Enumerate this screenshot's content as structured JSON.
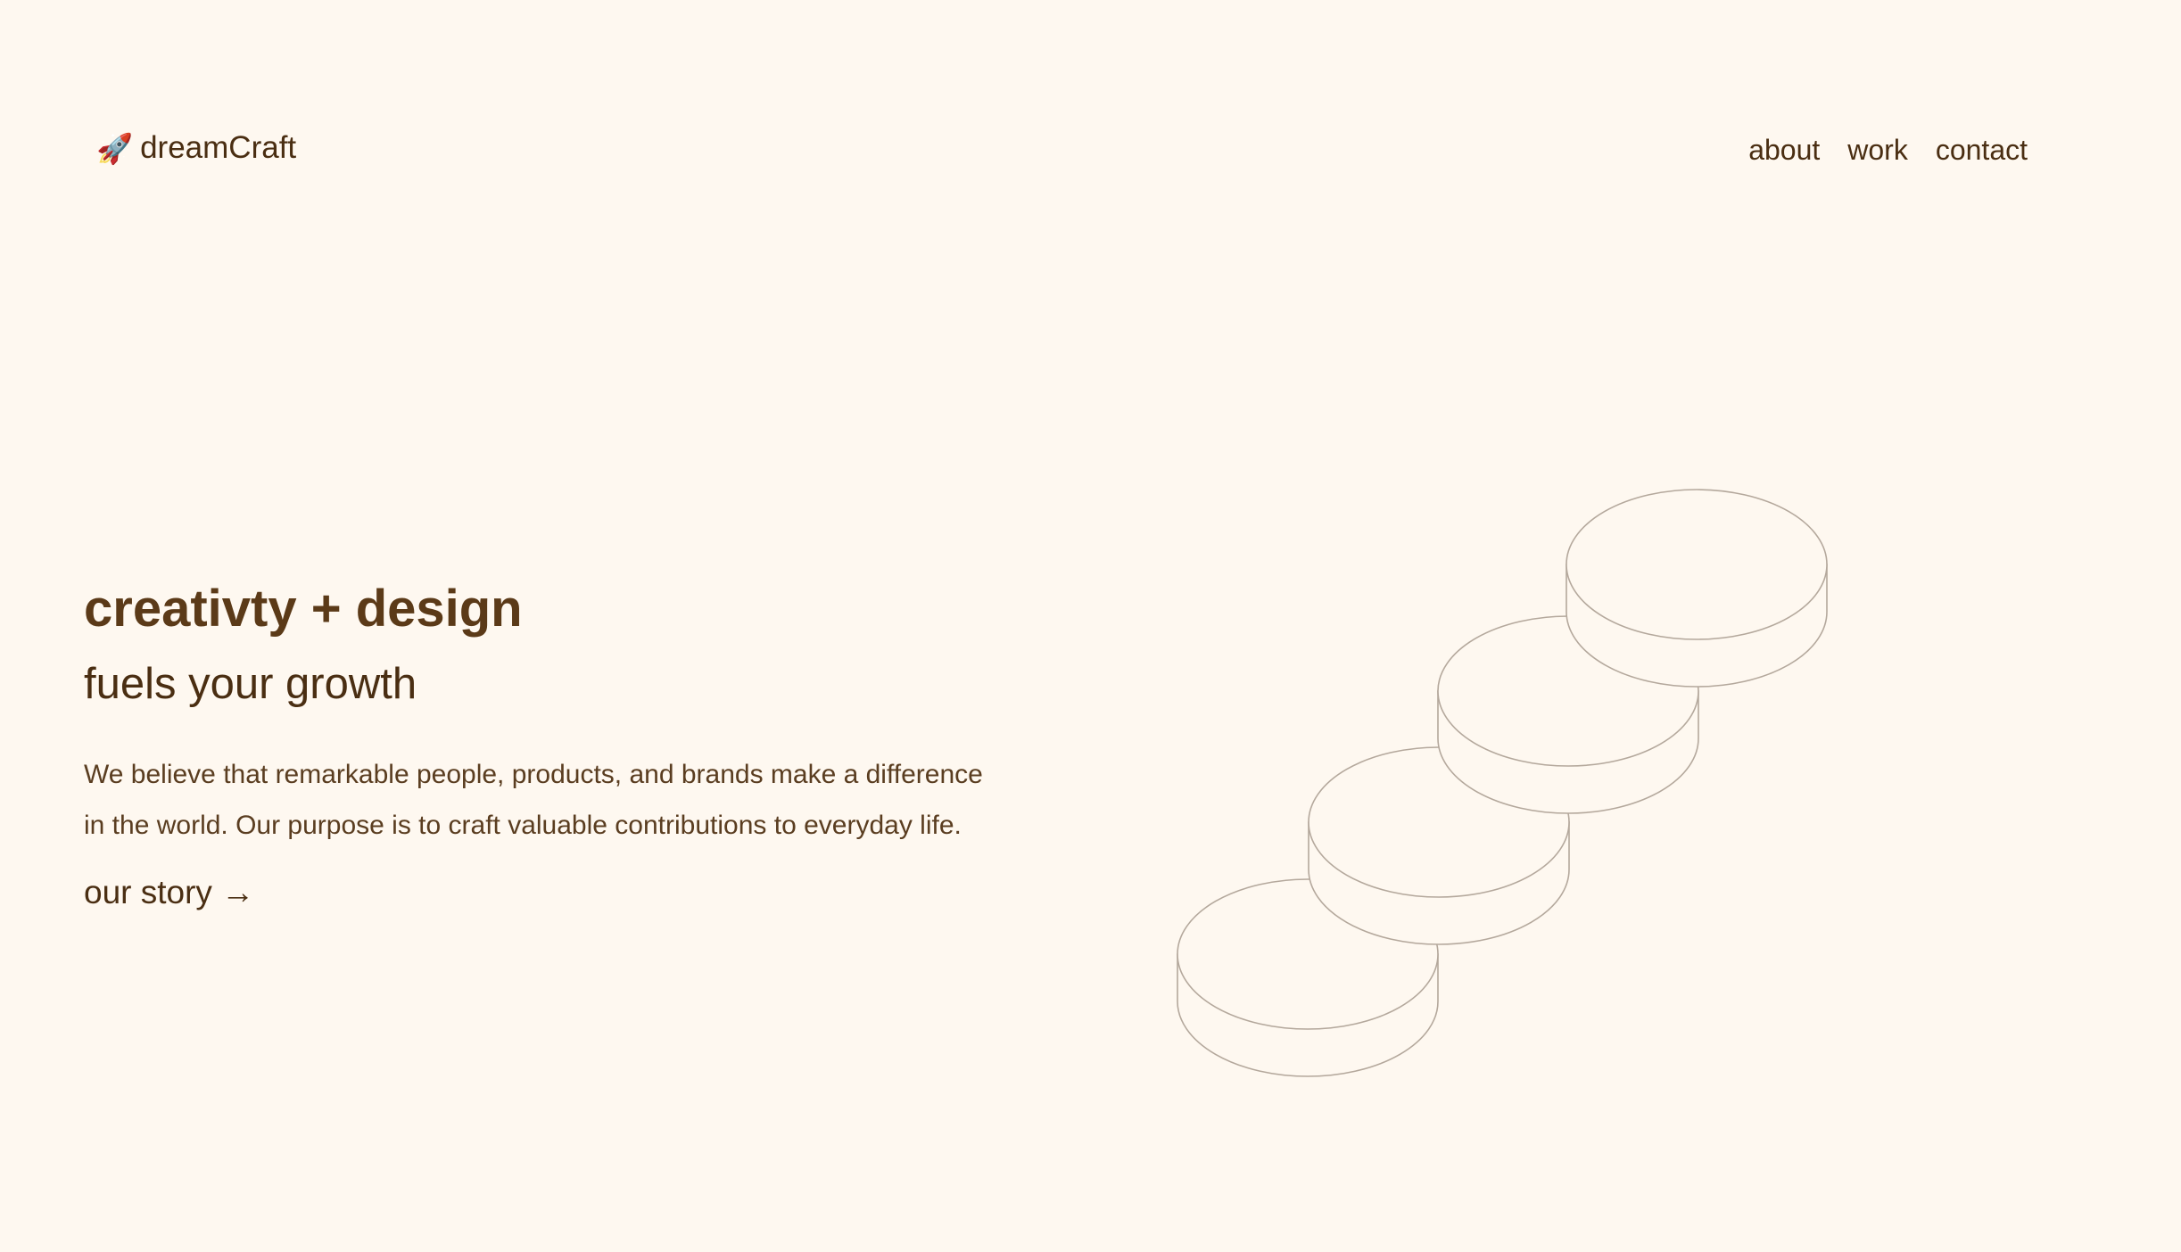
{
  "header": {
    "logo_icon": "rocket-icon",
    "logo_emoji": "🚀",
    "brand_name": "dreamCraft",
    "nav": [
      {
        "label": "about"
      },
      {
        "label": "work"
      },
      {
        "label": "contact"
      }
    ]
  },
  "hero": {
    "title": "creativty + design",
    "subtitle": "fuels your growth",
    "body": "We believe that remarkable people, products, and brands make a difference in the world. Our purpose is to craft valuable contributions to everyday life.",
    "cta_label": "our story →"
  },
  "illustration": {
    "name": "stacked-discs-stairs",
    "stroke_color": "#b4a89c"
  },
  "colors": {
    "background": "#fef8f0",
    "text": "#4a2e12",
    "heading": "#5b3a18"
  }
}
